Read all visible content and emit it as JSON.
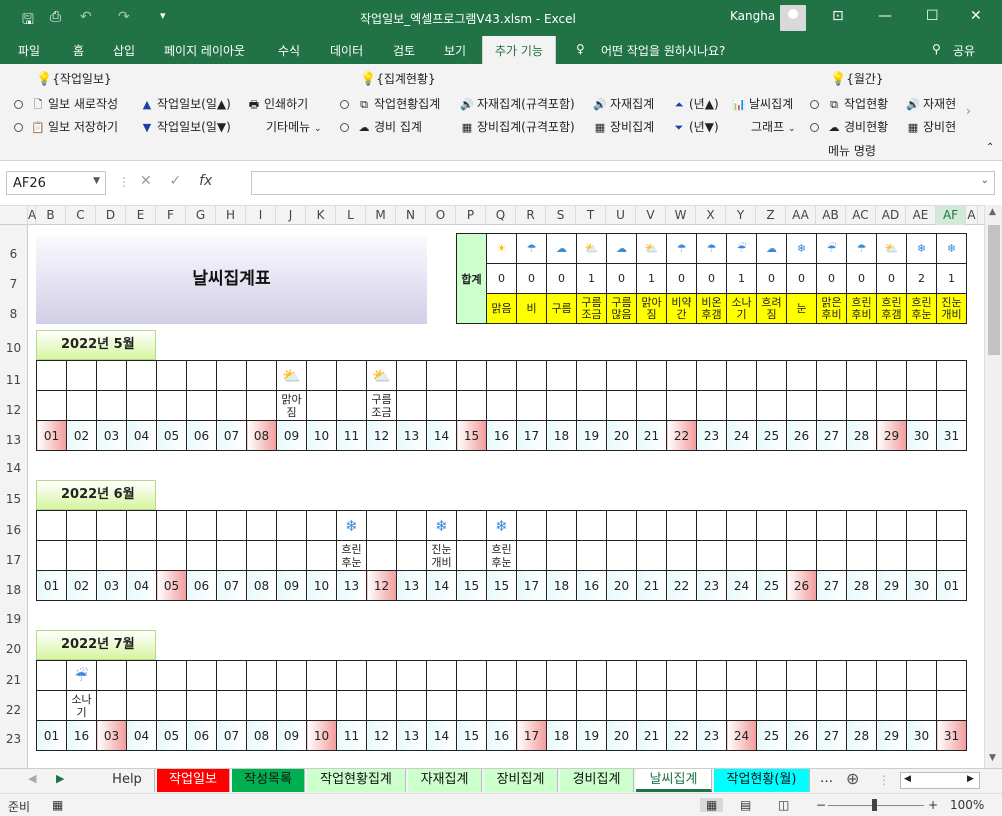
{
  "title_bar": {
    "doc_title": "작업일보_엑셀프로그램V43.xlsm  -  Excel",
    "user": "Kangha"
  },
  "ribbon_tabs": [
    "파일",
    "홈",
    "삽입",
    "페이지 레이아웃",
    "수식",
    "데이터",
    "검토",
    "보기",
    "추가 기능"
  ],
  "tell_me": "어떤 작업을 원하시나요?",
  "share": "공유",
  "ribbon": {
    "group1": "{작업일보}",
    "group2": "{집계현황}",
    "group3": "{월간}",
    "new_report": "일보 새로작성",
    "save_report": "일보 저장하기",
    "report_up": "작업일보(일▲)",
    "report_down": "작업일보(일▼)",
    "print": "인쇄하기",
    "other_menu": "기타메뉴",
    "work_status_agg": "작업현황집계",
    "expense_agg": "경비 집계",
    "material_agg_spec": "자재집계(규격포함)",
    "equip_agg_spec": "장비집계(규격포함)",
    "material_agg": "자재집계",
    "equip_agg": "장비집계",
    "year_up": "(년▲)",
    "year_down": "(년▼)",
    "weather_agg": "날씨집계",
    "graph": "그래프",
    "m_work": "작업현황",
    "m_expense": "경비현황",
    "m_material": "자재현",
    "m_equip": "장비현",
    "menu_cmd": "메뉴 명령"
  },
  "formula_bar": {
    "name_box": "AF26",
    "formula": ""
  },
  "columns": [
    "A",
    "B",
    "C",
    "D",
    "E",
    "F",
    "G",
    "H",
    "I",
    "J",
    "K",
    "L",
    "M",
    "N",
    "O",
    "P",
    "Q",
    "R",
    "S",
    "T",
    "U",
    "V",
    "W",
    "X",
    "Y",
    "Z",
    "AA",
    "AB",
    "AC",
    "AD",
    "AE",
    "AF",
    "A"
  ],
  "rows": [
    "6",
    "7",
    "8",
    "10",
    "11",
    "12",
    "13",
    "14",
    "15",
    "16",
    "17",
    "18",
    "19",
    "20",
    "21",
    "22",
    "23"
  ],
  "sheet": {
    "title": "날씨집계표",
    "total_label": "합계",
    "weather_types": [
      {
        "name": "맑음",
        "count": "0",
        "icon": "sun"
      },
      {
        "name": "비",
        "count": "0",
        "icon": "rain"
      },
      {
        "name": "구름",
        "count": "0",
        "icon": "cloud"
      },
      {
        "name": "구름조금",
        "count": "1",
        "icon": "partly-sunny"
      },
      {
        "name": "구름많음",
        "count": "0",
        "icon": "mostly-cloudy"
      },
      {
        "name": "맑아짐",
        "count": "1",
        "icon": "clearing"
      },
      {
        "name": "비약간",
        "count": "0",
        "icon": "light-rain"
      },
      {
        "name": "비온후갬",
        "count": "0",
        "icon": "rain-then-clear"
      },
      {
        "name": "소나기",
        "count": "1",
        "icon": "shower"
      },
      {
        "name": "흐려짐",
        "count": "0",
        "icon": "clouding"
      },
      {
        "name": "눈",
        "count": "0",
        "icon": "snow"
      },
      {
        "name": "맑은후비",
        "count": "0",
        "icon": "clear-then-rain"
      },
      {
        "name": "흐린후비",
        "count": "0",
        "icon": "cloudy-then-rain"
      },
      {
        "name": "흐린후갬",
        "count": "0",
        "icon": "cloudy-then-clear"
      },
      {
        "name": "흐린후눈",
        "count": "2",
        "icon": "cloudy-then-snow"
      },
      {
        "name": "진눈개비",
        "count": "1",
        "icon": "sleet"
      }
    ],
    "months": [
      {
        "label": "2022년 5월",
        "days": [
          "01",
          "02",
          "03",
          "04",
          "05",
          "06",
          "07",
          "08",
          "09",
          "10",
          "11",
          "12",
          "13",
          "14",
          "15",
          "16",
          "17",
          "18",
          "19",
          "20",
          "21",
          "22",
          "23",
          "24",
          "25",
          "26",
          "27",
          "28",
          "29",
          "30",
          "31"
        ],
        "red": [
          0,
          7,
          14,
          21,
          28
        ],
        "weather": {
          "8": "맑아짐",
          "11": "구름조금"
        }
      },
      {
        "label": "2022년 6월",
        "days": [
          "01",
          "02",
          "03",
          "04",
          "05",
          "06",
          "07",
          "08",
          "09",
          "10",
          "13",
          "12",
          "13",
          "14",
          "15",
          "15",
          "17",
          "18",
          "16",
          "20",
          "21",
          "22",
          "23",
          "24",
          "25",
          "26",
          "27",
          "28",
          "29",
          "30",
          "01"
        ],
        "red": [
          4,
          11,
          25
        ],
        "weather": {
          "10": "흐린후눈",
          "13": "진눈개비",
          "15": "흐린후눈"
        }
      },
      {
        "label": "2022년 7월",
        "days": [
          "01",
          "16",
          "03",
          "04",
          "05",
          "06",
          "07",
          "08",
          "09",
          "10",
          "11",
          "12",
          "13",
          "14",
          "15",
          "16",
          "17",
          "18",
          "19",
          "20",
          "21",
          "22",
          "23",
          "24",
          "25",
          "26",
          "27",
          "28",
          "29",
          "30",
          "31"
        ],
        "red": [
          2,
          9,
          16,
          23,
          30
        ],
        "weather": {
          "1": "소나기"
        }
      }
    ]
  },
  "sheet_tabs": [
    {
      "label": "Help",
      "color": "#f3f3f3",
      "text": "#333"
    },
    {
      "label": "작업일보",
      "color": "#ff0000",
      "text": "#ffffff"
    },
    {
      "label": "작성목록",
      "color": "#00b050",
      "text": "#111111"
    },
    {
      "label": "작업현황집계",
      "color": "#ccffcc",
      "text": "#111111"
    },
    {
      "label": "자재집계",
      "color": "#ccffcc",
      "text": "#111111"
    },
    {
      "label": "장비집계",
      "color": "#ccffcc",
      "text": "#111111"
    },
    {
      "label": "경비집계",
      "color": "#ccffcc",
      "text": "#111111"
    },
    {
      "label": "날씨집계",
      "color": "#ffffff",
      "text": "#217346"
    },
    {
      "label": "작업현황(월)",
      "color": "#00ffff",
      "text": "#111111"
    }
  ],
  "status": {
    "ready": "준비",
    "zoom": "100%"
  },
  "colors": {
    "excel_green": "#217346",
    "holiday_red": "#f29a9a",
    "weather_yellow": "#ffff00",
    "total_green": "#ccffcc"
  }
}
